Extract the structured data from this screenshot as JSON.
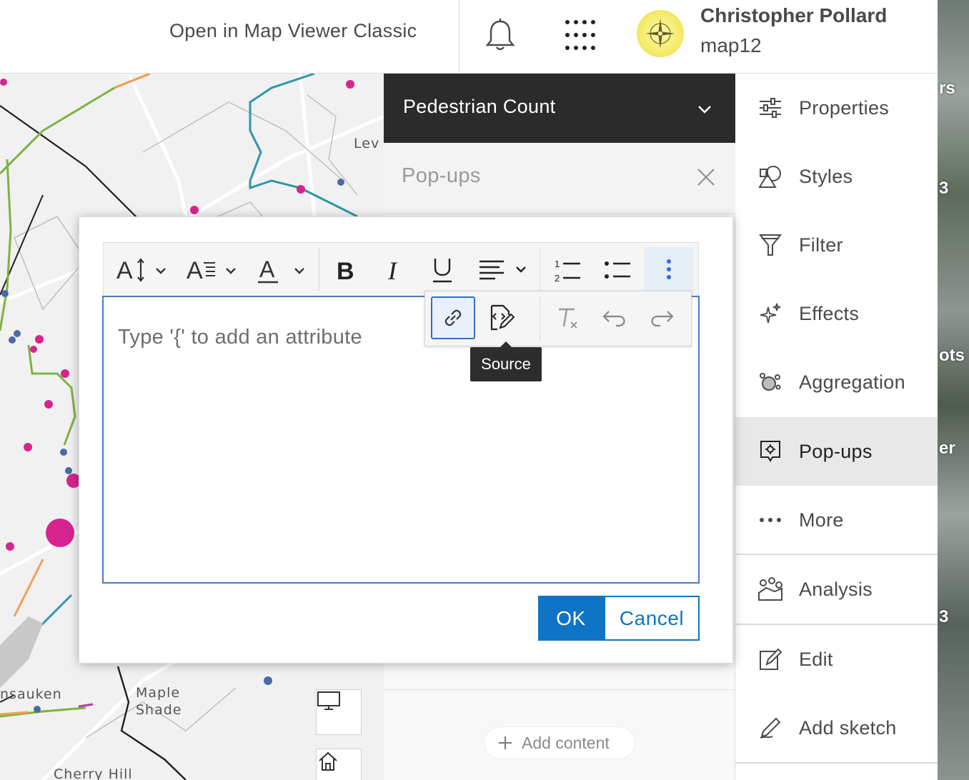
{
  "header": {
    "open_link": "Open in Map Viewer Classic",
    "notifications_icon": "bell-icon",
    "apps_icon": "app-launcher-icon",
    "user_name": "Christopher Pollard",
    "user_sub": "map12"
  },
  "map": {
    "labels": [
      "Lev",
      "nsauken",
      "Maple",
      "Shade",
      "Cherry Hill"
    ],
    "controls": [
      "display-icon",
      "home-icon"
    ]
  },
  "layer_panel": {
    "layer_title": "Pedestrian Count",
    "section_title": "Pop-ups",
    "add_content": "Add content"
  },
  "action_bar": {
    "items": [
      {
        "label": "Properties",
        "icon": "sliders-icon",
        "active": false
      },
      {
        "label": "Styles",
        "icon": "styles-icon",
        "active": false
      },
      {
        "label": "Filter",
        "icon": "filter-icon",
        "active": false
      },
      {
        "label": "Effects",
        "icon": "sparkle-icon",
        "active": false
      },
      {
        "label": "Aggregation",
        "icon": "aggregation-icon",
        "active": false
      },
      {
        "label": "Pop-ups",
        "icon": "popup-icon",
        "active": true
      },
      {
        "label": "More",
        "icon": "ellipsis-icon",
        "active": false
      },
      {
        "label": "Analysis",
        "icon": "analysis-icon",
        "active": false
      },
      {
        "label": "Edit",
        "icon": "edit-icon",
        "active": false
      },
      {
        "label": "Add sketch",
        "icon": "sketch-icon",
        "active": false
      }
    ]
  },
  "side_strip_text": [
    "rs",
    "3",
    "ots",
    "er",
    "3"
  ],
  "editor": {
    "placeholder": "Type '{' to add an attribute",
    "tooltip": "Source",
    "ok_label": "OK",
    "cancel_label": "Cancel"
  },
  "colors": {
    "accent": "#0f74c5",
    "header_dark": "#2b2b2b",
    "active_item": "#e8e8e8",
    "magenta_point": "#d6248f",
    "blue_point": "#4a6aa5",
    "green_line": "#7cb342",
    "teal_line": "#2e97a8",
    "orange_line": "#f0a050"
  }
}
